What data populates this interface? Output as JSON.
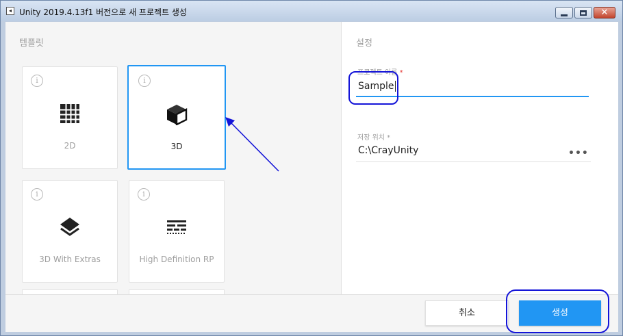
{
  "window": {
    "title": "Unity 2019.4.13f1 버전으로 새 프로젝트 생성",
    "close_glyph": "✕"
  },
  "templates": {
    "heading": "템플릿",
    "items": [
      {
        "label": "2D",
        "icon": "grid-icon",
        "selected": false
      },
      {
        "label": "3D",
        "icon": "cube-icon",
        "selected": true
      },
      {
        "label": "3D With Extras",
        "icon": "layers-icon",
        "selected": false
      },
      {
        "label": "High Definition RP",
        "icon": "hdrp-icon",
        "selected": false
      }
    ],
    "info_glyph": "i"
  },
  "settings": {
    "heading": "설정",
    "project_name": {
      "label": "프로젝트 이름",
      "required_mark": "*",
      "value": "Sample"
    },
    "location": {
      "label": "저장 위치",
      "required_mark": "*",
      "value": "C:\\CrayUnity",
      "browse_glyph": "•••"
    }
  },
  "footer": {
    "cancel_label": "취소",
    "create_label": "생성"
  },
  "colors": {
    "accent": "#2196f3",
    "annotation": "#1414d8",
    "required": "#e53935"
  }
}
